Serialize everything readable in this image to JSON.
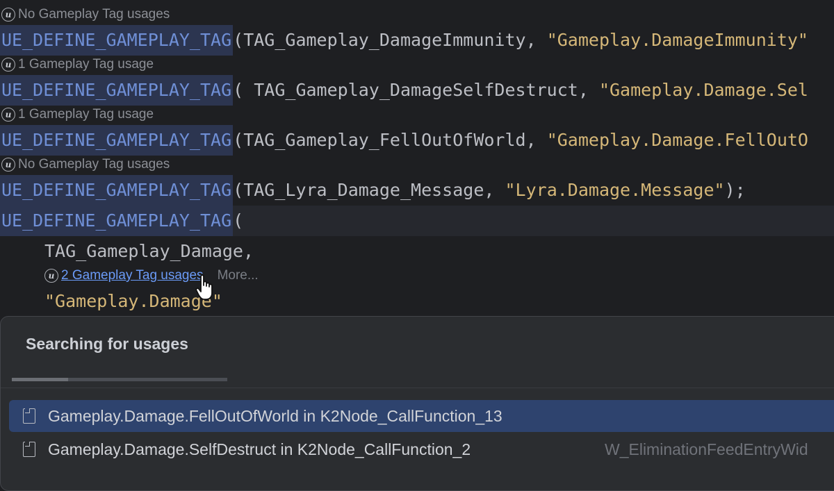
{
  "editor": {
    "hint_icon": "unreal-engine-icon",
    "lines": [
      {
        "hint": "No Gameplay Tag usages",
        "macro": "UE_DEFINE_GAMEPLAY_TAG",
        "args": "(TAG_Gameplay_DamageImmunity, ",
        "string": "\"Gameplay.DamageImmunity\""
      },
      {
        "hint": "1 Gameplay Tag usage",
        "macro": "UE_DEFINE_GAMEPLAY_TAG",
        "args": "( TAG_Gameplay_DamageSelfDestruct, ",
        "string": "\"Gameplay.Damage.Sel"
      },
      {
        "hint": "1 Gameplay Tag usage",
        "macro": "UE_DEFINE_GAMEPLAY_TAG",
        "args": "(TAG_Gameplay_FellOutOfWorld, ",
        "string": "\"Gameplay.Damage.FellOutO"
      },
      {
        "hint": "No Gameplay Tag usages",
        "macro": "UE_DEFINE_GAMEPLAY_TAG",
        "args": "(TAG_Lyra_Damage_Message, ",
        "string": "\"Lyra.Damage.Message\"",
        "tail": ");"
      }
    ],
    "current_line": {
      "macro": "UE_DEFINE_GAMEPLAY_TAG",
      "args": "("
    },
    "param_line": "TAG_Gameplay_Damage,",
    "inner_hint": {
      "link": "2 Gameplay Tag usages",
      "more": "More..."
    },
    "string_line": "\"Gameplay.Damage\""
  },
  "popup": {
    "title": "Searching for usages",
    "progress": 0.26,
    "results": [
      {
        "text": "Gameplay.Damage.FellOutOfWorld in K2Node_CallFunction_13",
        "location": "",
        "selected": true
      },
      {
        "text": "Gameplay.Damage.SelfDestruct in K2Node_CallFunction_2",
        "location": "W_EliminationFeedEntryWid",
        "selected": false
      }
    ]
  },
  "colors": {
    "background": "#1e1f22",
    "macro": "#6f8fd6",
    "string": "#d5b778",
    "link": "#6b9bf7",
    "selection": "#2e436e"
  }
}
